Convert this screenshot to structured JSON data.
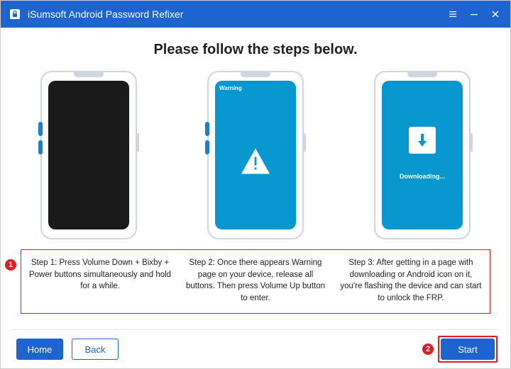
{
  "app": {
    "title": "iSumsoft Android Password Refixer"
  },
  "page": {
    "heading": "Please follow the steps below."
  },
  "phones": {
    "warning_label": "Warning",
    "download_label": "Downloading..."
  },
  "callouts": {
    "one": "1",
    "two": "2"
  },
  "steps": {
    "s1": "Step 1: Press Volume Down + Bixby + Power buttons simultaneously and hold for a while.",
    "s2": "Step 2: Once there appears Warning page on your device, release all buttons. Then press Volume Up button to enter.",
    "s3": "Step 3: After getting in a page with downloading or Android icon on it, you're flashing the device and can start to unlock the FRP."
  },
  "footer": {
    "home": "Home",
    "back": "Back",
    "start": "Start"
  }
}
